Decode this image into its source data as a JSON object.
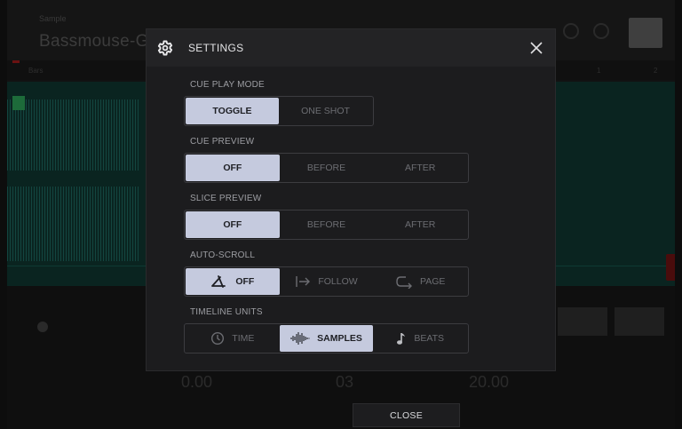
{
  "background": {
    "header_small": "Sample",
    "title": "Bassmouse-Ga",
    "ruler_labels": [
      "Bars",
      "1",
      "2"
    ],
    "lower_values": [
      "0.00",
      "03",
      "20.00"
    ],
    "accent_colors": {
      "wave": "#0a2420",
      "marker_green": "#1d6b3a",
      "marker_red": "#4a0c0c"
    }
  },
  "modal": {
    "title": "SETTINGS",
    "icons": {
      "header": "gear-icon",
      "close": "close-icon"
    },
    "sections": {
      "cue_play_mode": {
        "label": "CUE PLAY MODE",
        "options": [
          "TOGGLE",
          "ONE SHOT"
        ],
        "selected": "TOGGLE"
      },
      "cue_preview": {
        "label": "CUE PREVIEW",
        "options": [
          "OFF",
          "BEFORE",
          "AFTER"
        ],
        "selected": "OFF"
      },
      "slice_preview": {
        "label": "SLICE PREVIEW",
        "options": [
          "OFF",
          "BEFORE",
          "AFTER"
        ],
        "selected": "OFF"
      },
      "auto_scroll": {
        "label": "AUTO-SCROLL",
        "options": [
          "OFF",
          "FOLLOW",
          "PAGE"
        ],
        "icons": [
          "scroll-off-icon",
          "follow-arrow-icon",
          "page-return-icon"
        ],
        "selected": "OFF"
      },
      "timeline_units": {
        "label": "TIMELINE UNITS",
        "options": [
          "TIME",
          "SAMPLES",
          "BEATS"
        ],
        "icons": [
          "clock-icon",
          "waveform-icon",
          "music-note-icon"
        ],
        "selected": "SAMPLES"
      }
    },
    "colors": {
      "active_segment": "#c5cade",
      "panel": "#1c1c1e",
      "header": "#232325"
    }
  },
  "footer": {
    "close_label": "CLOSE"
  }
}
